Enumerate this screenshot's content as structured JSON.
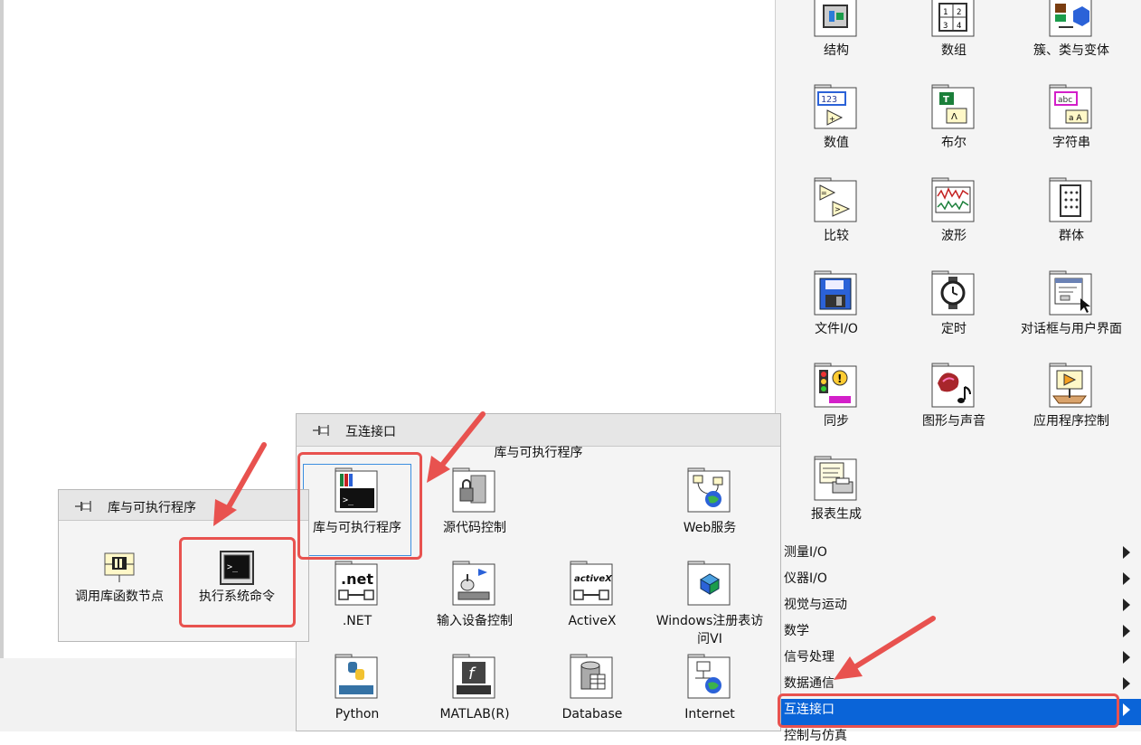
{
  "right_palette": {
    "items": [
      {
        "label": "结构",
        "icon": "structure-icon"
      },
      {
        "label": "数组",
        "icon": "array-icon"
      },
      {
        "label": "簇、类与变体",
        "icon": "cluster-class-variant-icon"
      },
      {
        "label": "数值",
        "icon": "numeric-icon"
      },
      {
        "label": "布尔",
        "icon": "boolean-icon"
      },
      {
        "label": "字符串",
        "icon": "string-icon"
      },
      {
        "label": "比较",
        "icon": "comparison-icon"
      },
      {
        "label": "波形",
        "icon": "waveform-icon"
      },
      {
        "label": "群体",
        "icon": "collection-icon"
      },
      {
        "label": "文件I/O",
        "icon": "file-io-icon"
      },
      {
        "label": "定时",
        "icon": "timing-icon"
      },
      {
        "label": "对话框与用户界面",
        "icon": "dialog-ui-icon"
      },
      {
        "label": "同步",
        "icon": "synchronization-icon"
      },
      {
        "label": "图形与声音",
        "icon": "graphics-sound-icon"
      },
      {
        "label": "应用程序控制",
        "icon": "application-control-icon"
      },
      {
        "label": "报表生成",
        "icon": "report-generation-icon"
      }
    ],
    "menu": [
      {
        "label": "测量I/O"
      },
      {
        "label": "仪器I/O"
      },
      {
        "label": "视觉与运动"
      },
      {
        "label": "数学"
      },
      {
        "label": "信号处理"
      },
      {
        "label": "数据通信"
      },
      {
        "label": "互连接口",
        "selected": true
      },
      {
        "label": "控制与仿真"
      }
    ]
  },
  "middle_palette": {
    "title": "互连接口",
    "subtitle": "库与可执行程序",
    "items": [
      {
        "label": "库与可执行程序",
        "icon": "libraries-executables-icon"
      },
      {
        "label": "源代码控制",
        "icon": "source-control-icon"
      },
      {
        "label": "Web服务",
        "icon": "web-services-icon"
      },
      {
        "label": ".NET",
        "icon": "dotnet-icon"
      },
      {
        "label": "输入设备控制",
        "icon": "input-device-icon"
      },
      {
        "label": "ActiveX",
        "icon": "activex-icon"
      },
      {
        "label": "Windows注册表访问VI",
        "icon": "windows-registry-icon"
      },
      {
        "label": "Python",
        "icon": "python-icon"
      },
      {
        "label": "MATLAB(R)",
        "icon": "matlab-icon"
      },
      {
        "label": "Database",
        "icon": "database-icon"
      },
      {
        "label": "Internet",
        "icon": "internet-icon"
      }
    ]
  },
  "left_palette": {
    "title": "库与可执行程序",
    "items": [
      {
        "label": "调用库函数节点",
        "icon": "call-library-function-icon"
      },
      {
        "label": "执行系统命令",
        "icon": "system-exec-icon"
      }
    ]
  },
  "colors": {
    "accent": "#0a64d8",
    "annotation": "#e8524f"
  }
}
